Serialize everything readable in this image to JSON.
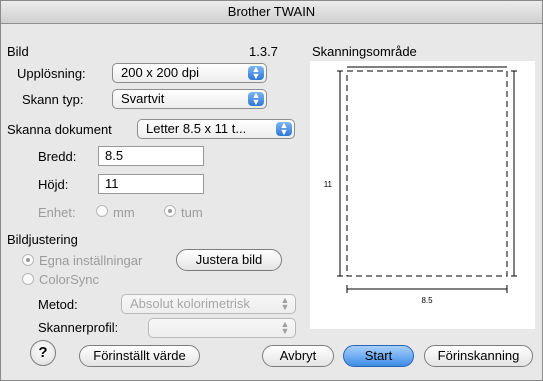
{
  "window": {
    "title": "Brother TWAIN"
  },
  "bild": {
    "section_title": "Bild",
    "version": "1.3.7",
    "resolution_label": "Upplösning:",
    "resolution_value": "200 x 200 dpi",
    "scan_type_label": "Skann typ:",
    "scan_type_value": "Svartvit"
  },
  "document": {
    "label": "Skanna dokument",
    "value": "Letter  8.5 x 11 t...",
    "width_label": "Bredd:",
    "width_value": "8.5",
    "height_label": "Höjd:",
    "height_value": "11",
    "unit_label": "Enhet:",
    "unit_mm": "mm",
    "unit_tum": "tum",
    "unit_selected": "tum"
  },
  "adjust": {
    "section_title": "Bildjustering",
    "own_settings": "Egna inställningar",
    "adjust_button": "Justera bild",
    "colorsync": "ColorSync",
    "method_label": "Metod:",
    "method_value": "Absolut kolorimetrisk",
    "profile_label": "Skannerprofil:",
    "profile_value": ""
  },
  "scan_area": {
    "title": "Skanningsområde",
    "height_dim": "11",
    "width_dim": "8.5"
  },
  "footer": {
    "help": "?",
    "preset": "Förinställt värde",
    "cancel": "Avbryt",
    "start": "Start",
    "prescan": "Förinskanning"
  }
}
